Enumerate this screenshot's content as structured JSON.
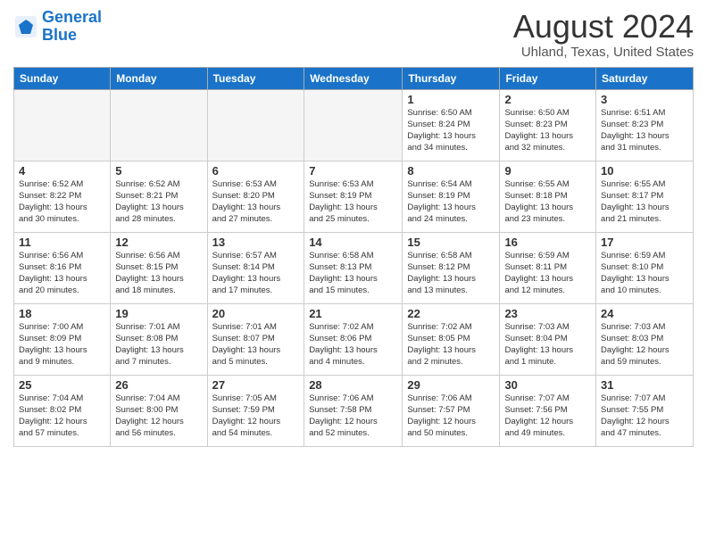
{
  "logo": {
    "line1": "General",
    "line2": "Blue"
  },
  "title": "August 2024",
  "subtitle": "Uhland, Texas, United States",
  "weekdays": [
    "Sunday",
    "Monday",
    "Tuesday",
    "Wednesday",
    "Thursday",
    "Friday",
    "Saturday"
  ],
  "weeks": [
    [
      {
        "day": "",
        "info": ""
      },
      {
        "day": "",
        "info": ""
      },
      {
        "day": "",
        "info": ""
      },
      {
        "day": "",
        "info": ""
      },
      {
        "day": "1",
        "info": "Sunrise: 6:50 AM\nSunset: 8:24 PM\nDaylight: 13 hours\nand 34 minutes."
      },
      {
        "day": "2",
        "info": "Sunrise: 6:50 AM\nSunset: 8:23 PM\nDaylight: 13 hours\nand 32 minutes."
      },
      {
        "day": "3",
        "info": "Sunrise: 6:51 AM\nSunset: 8:23 PM\nDaylight: 13 hours\nand 31 minutes."
      }
    ],
    [
      {
        "day": "4",
        "info": "Sunrise: 6:52 AM\nSunset: 8:22 PM\nDaylight: 13 hours\nand 30 minutes."
      },
      {
        "day": "5",
        "info": "Sunrise: 6:52 AM\nSunset: 8:21 PM\nDaylight: 13 hours\nand 28 minutes."
      },
      {
        "day": "6",
        "info": "Sunrise: 6:53 AM\nSunset: 8:20 PM\nDaylight: 13 hours\nand 27 minutes."
      },
      {
        "day": "7",
        "info": "Sunrise: 6:53 AM\nSunset: 8:19 PM\nDaylight: 13 hours\nand 25 minutes."
      },
      {
        "day": "8",
        "info": "Sunrise: 6:54 AM\nSunset: 8:19 PM\nDaylight: 13 hours\nand 24 minutes."
      },
      {
        "day": "9",
        "info": "Sunrise: 6:55 AM\nSunset: 8:18 PM\nDaylight: 13 hours\nand 23 minutes."
      },
      {
        "day": "10",
        "info": "Sunrise: 6:55 AM\nSunset: 8:17 PM\nDaylight: 13 hours\nand 21 minutes."
      }
    ],
    [
      {
        "day": "11",
        "info": "Sunrise: 6:56 AM\nSunset: 8:16 PM\nDaylight: 13 hours\nand 20 minutes."
      },
      {
        "day": "12",
        "info": "Sunrise: 6:56 AM\nSunset: 8:15 PM\nDaylight: 13 hours\nand 18 minutes."
      },
      {
        "day": "13",
        "info": "Sunrise: 6:57 AM\nSunset: 8:14 PM\nDaylight: 13 hours\nand 17 minutes."
      },
      {
        "day": "14",
        "info": "Sunrise: 6:58 AM\nSunset: 8:13 PM\nDaylight: 13 hours\nand 15 minutes."
      },
      {
        "day": "15",
        "info": "Sunrise: 6:58 AM\nSunset: 8:12 PM\nDaylight: 13 hours\nand 13 minutes."
      },
      {
        "day": "16",
        "info": "Sunrise: 6:59 AM\nSunset: 8:11 PM\nDaylight: 13 hours\nand 12 minutes."
      },
      {
        "day": "17",
        "info": "Sunrise: 6:59 AM\nSunset: 8:10 PM\nDaylight: 13 hours\nand 10 minutes."
      }
    ],
    [
      {
        "day": "18",
        "info": "Sunrise: 7:00 AM\nSunset: 8:09 PM\nDaylight: 13 hours\nand 9 minutes."
      },
      {
        "day": "19",
        "info": "Sunrise: 7:01 AM\nSunset: 8:08 PM\nDaylight: 13 hours\nand 7 minutes."
      },
      {
        "day": "20",
        "info": "Sunrise: 7:01 AM\nSunset: 8:07 PM\nDaylight: 13 hours\nand 5 minutes."
      },
      {
        "day": "21",
        "info": "Sunrise: 7:02 AM\nSunset: 8:06 PM\nDaylight: 13 hours\nand 4 minutes."
      },
      {
        "day": "22",
        "info": "Sunrise: 7:02 AM\nSunset: 8:05 PM\nDaylight: 13 hours\nand 2 minutes."
      },
      {
        "day": "23",
        "info": "Sunrise: 7:03 AM\nSunset: 8:04 PM\nDaylight: 13 hours\nand 1 minute."
      },
      {
        "day": "24",
        "info": "Sunrise: 7:03 AM\nSunset: 8:03 PM\nDaylight: 12 hours\nand 59 minutes."
      }
    ],
    [
      {
        "day": "25",
        "info": "Sunrise: 7:04 AM\nSunset: 8:02 PM\nDaylight: 12 hours\nand 57 minutes."
      },
      {
        "day": "26",
        "info": "Sunrise: 7:04 AM\nSunset: 8:00 PM\nDaylight: 12 hours\nand 56 minutes."
      },
      {
        "day": "27",
        "info": "Sunrise: 7:05 AM\nSunset: 7:59 PM\nDaylight: 12 hours\nand 54 minutes."
      },
      {
        "day": "28",
        "info": "Sunrise: 7:06 AM\nSunset: 7:58 PM\nDaylight: 12 hours\nand 52 minutes."
      },
      {
        "day": "29",
        "info": "Sunrise: 7:06 AM\nSunset: 7:57 PM\nDaylight: 12 hours\nand 50 minutes."
      },
      {
        "day": "30",
        "info": "Sunrise: 7:07 AM\nSunset: 7:56 PM\nDaylight: 12 hours\nand 49 minutes."
      },
      {
        "day": "31",
        "info": "Sunrise: 7:07 AM\nSunset: 7:55 PM\nDaylight: 12 hours\nand 47 minutes."
      }
    ]
  ]
}
